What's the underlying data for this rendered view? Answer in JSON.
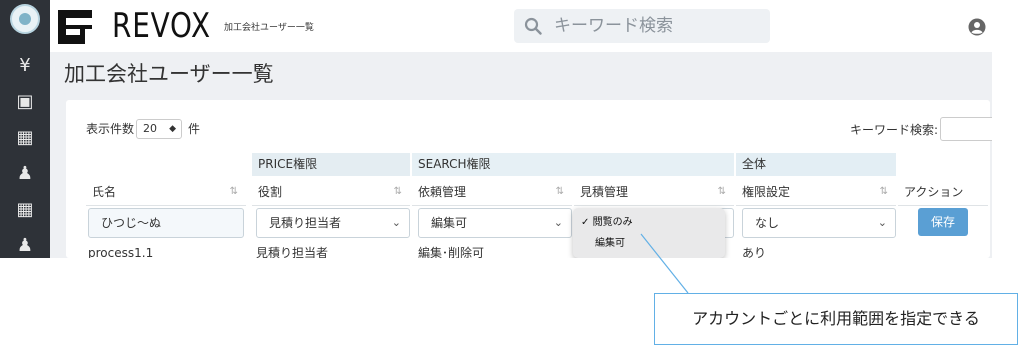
{
  "sidebar": {
    "items": [
      {
        "icon": "yen-icon",
        "glyph": "¥"
      },
      {
        "icon": "document-search-icon",
        "glyph": "▣"
      },
      {
        "icon": "building-add-icon",
        "glyph": "▦"
      },
      {
        "icon": "user-add-icon",
        "glyph": "♟"
      },
      {
        "icon": "building-icon",
        "glyph": "▦"
      },
      {
        "icon": "user-icon",
        "glyph": "♟"
      }
    ]
  },
  "header": {
    "brand": "REVOX",
    "subtitle": "加工会社ユーザー一覧",
    "search_placeholder": "キーワード検索"
  },
  "page": {
    "title": "加工会社ユーザー一覧"
  },
  "table_controls": {
    "per_page_label": "表示件数",
    "per_page_value": "20",
    "per_page_unit": "件",
    "keyword_label": "キーワード検索:"
  },
  "table": {
    "groups": {
      "price": "PRICE権限",
      "search": "SEARCH権限",
      "all": "全体"
    },
    "columns": {
      "name": "氏名",
      "role": "役割",
      "request": "依頼管理",
      "estimate": "見積管理",
      "permission": "権限設定",
      "action": "アクション"
    },
    "edit_row": {
      "name": "ひつじ〜ぬ",
      "role": "見積り担当者",
      "request": "編集可",
      "permission": "なし",
      "save": "保存"
    },
    "next_row": {
      "name": "process1.1",
      "role": "見積り担当者",
      "request": "編集･削除可",
      "permission": "あり"
    }
  },
  "dropdown": {
    "options": [
      "閲覧のみ",
      "編集可"
    ],
    "selected_mark": "✓"
  },
  "annotation": {
    "text": "アカウントごとに利用範囲を指定できる"
  }
}
